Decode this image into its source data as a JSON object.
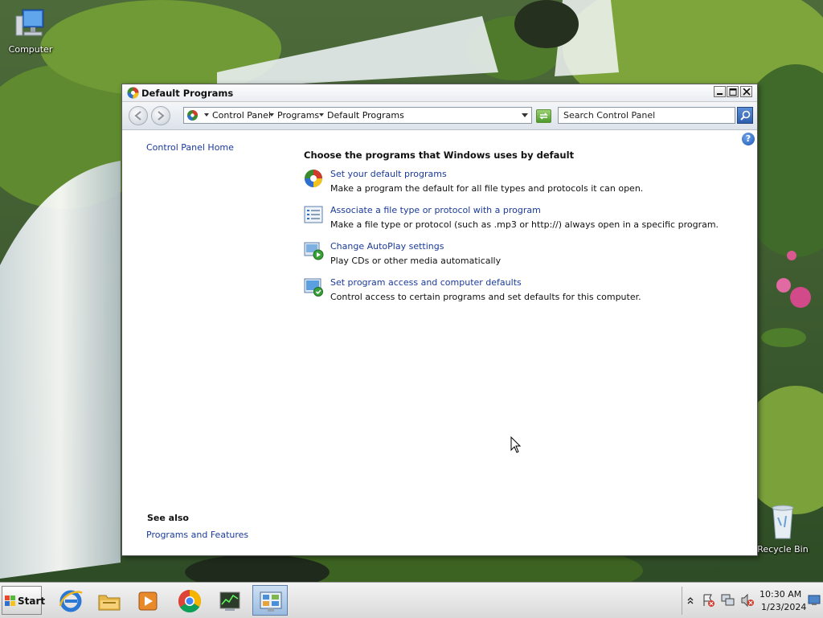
{
  "desktop": {
    "icons": [
      {
        "label": "Computer"
      },
      {
        "label": "Recycle Bin"
      }
    ]
  },
  "window": {
    "title": "Default Programs",
    "address": {
      "crumbs": [
        "Control Panel",
        "Programs",
        "Default Programs"
      ]
    },
    "search": {
      "placeholder": "Search Control Panel"
    },
    "sidebar": {
      "home_link": "Control Panel Home",
      "see_also_title": "See also",
      "see_also_links": [
        "Programs and Features"
      ]
    },
    "main": {
      "heading": "Choose the programs that Windows uses by default",
      "tasks": [
        {
          "icon": "default-programs-icon",
          "title": "Set your default programs",
          "description": "Make a program the default for all file types and protocols it can open."
        },
        {
          "icon": "file-association-icon",
          "title": "Associate a file type or protocol with a program",
          "description": "Make a file type or protocol (such as .mp3 or http://) always open in a specific program."
        },
        {
          "icon": "autoplay-icon",
          "title": "Change AutoPlay settings",
          "description": "Play CDs or other media automatically"
        },
        {
          "icon": "program-access-icon",
          "title": "Set program access and computer defaults",
          "description": "Control access to certain programs and set defaults for this computer."
        }
      ]
    }
  },
  "taskbar": {
    "start_label": "Start",
    "pinned": [
      "internet-explorer-icon",
      "file-explorer-icon",
      "media-player-icon",
      "chrome-icon",
      "task-manager-icon",
      "control-panel-icon"
    ],
    "clock": {
      "time": "10:30 AM",
      "date": "1/23/2024"
    }
  },
  "colors": {
    "link": "#1a3a9a",
    "taskbar": "#e6e6e6",
    "window_bg": "#ffffff"
  }
}
